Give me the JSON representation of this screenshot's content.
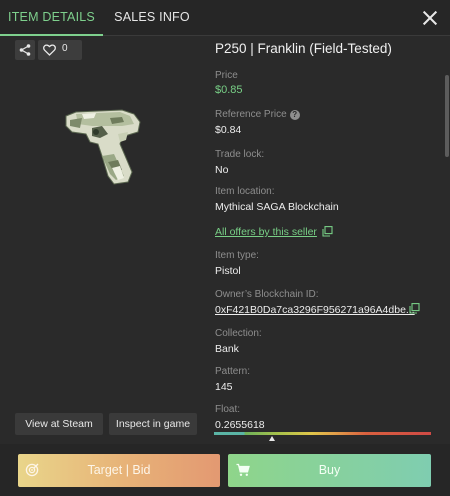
{
  "tabs": [
    {
      "label": "ITEM DETAILS",
      "active": true
    },
    {
      "label": "SALES INFO",
      "active": false
    }
  ],
  "item": {
    "favorites": "0",
    "title": "P250 | Franklin (Field-Tested)",
    "view_at_steam": "View at Steam",
    "inspect_in_game": "Inspect in game"
  },
  "details": {
    "price_label": "Price",
    "price": "$0.85",
    "reference_price_label": "Reference Price",
    "reference_price": "$0.84",
    "trade_lock_label": "Trade lock:",
    "trade_lock": "No",
    "location_label": "Item location:",
    "location": "Mythical SAGA Blockchain",
    "seller_offers_link": "All offers by this seller",
    "item_type_label": "Item type:",
    "item_type": "Pistol",
    "owner_label": "Owner’s Blockchain ID:",
    "owner_id": "0xF421B0Da7ca3296F956271a96A4dbe...",
    "collection_label": "Collection:",
    "collection": "Bank",
    "pattern_label": "Pattern:",
    "pattern": "145",
    "float_label": "Float:",
    "float": "0.2655618"
  },
  "footer": {
    "bid_label": "Target | Bid",
    "buy_label": "Buy"
  },
  "colors": {
    "accent": "#7ed08d",
    "background": "#2a2a2a",
    "bid_gradient_start": "#e9d58a",
    "bid_gradient_end": "#e39972",
    "buy_gradient_start": "#8fd58a",
    "buy_gradient_end": "#7fcdb0"
  },
  "icons": [
    "share-icon",
    "heart-icon",
    "help-icon",
    "copy-icon",
    "close-icon",
    "target-icon",
    "cart-icon"
  ]
}
